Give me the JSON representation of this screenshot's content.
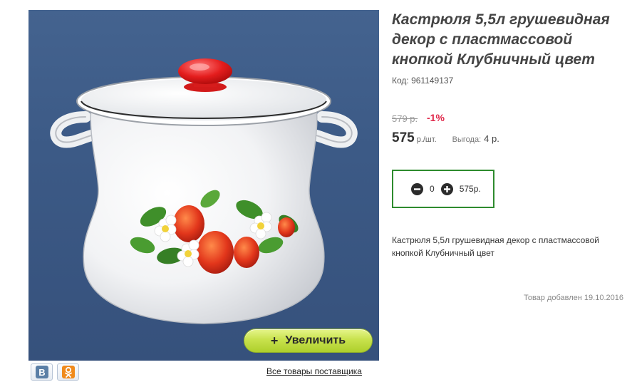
{
  "product": {
    "title": "Кастрюля 5,5л грушевидная декор с пластмассовой кнопкой Клубничный цвет",
    "code": "Код: 961149137",
    "old_price": "579 р.",
    "discount": "-1%",
    "price": "575",
    "price_unit": "р./шт.",
    "benefit_label": "Выгода:",
    "benefit_value": "4 р.",
    "description": "Кастрюля 5,5л грушевидная декор с пластмассовой кнопкой Клубничный цвет",
    "added_date": "Товар добавлен 19.10.2016"
  },
  "cart": {
    "quantity": "0",
    "sum": "575р."
  },
  "image_panel": {
    "zoom_label": "Увеличить",
    "zoom_plus": "+",
    "supplier_link": "Все товары поставщика"
  },
  "social": {
    "vk_letter": "В",
    "ok_letter": "ОК",
    "vk_color": "#5b7fa6",
    "ok_color": "#f08a1c"
  },
  "colors": {
    "photo_background": "#3f5e8a",
    "cart_border": "#2e8b2e",
    "discount": "#e0284a",
    "zoom_button": "#c8e24d"
  }
}
